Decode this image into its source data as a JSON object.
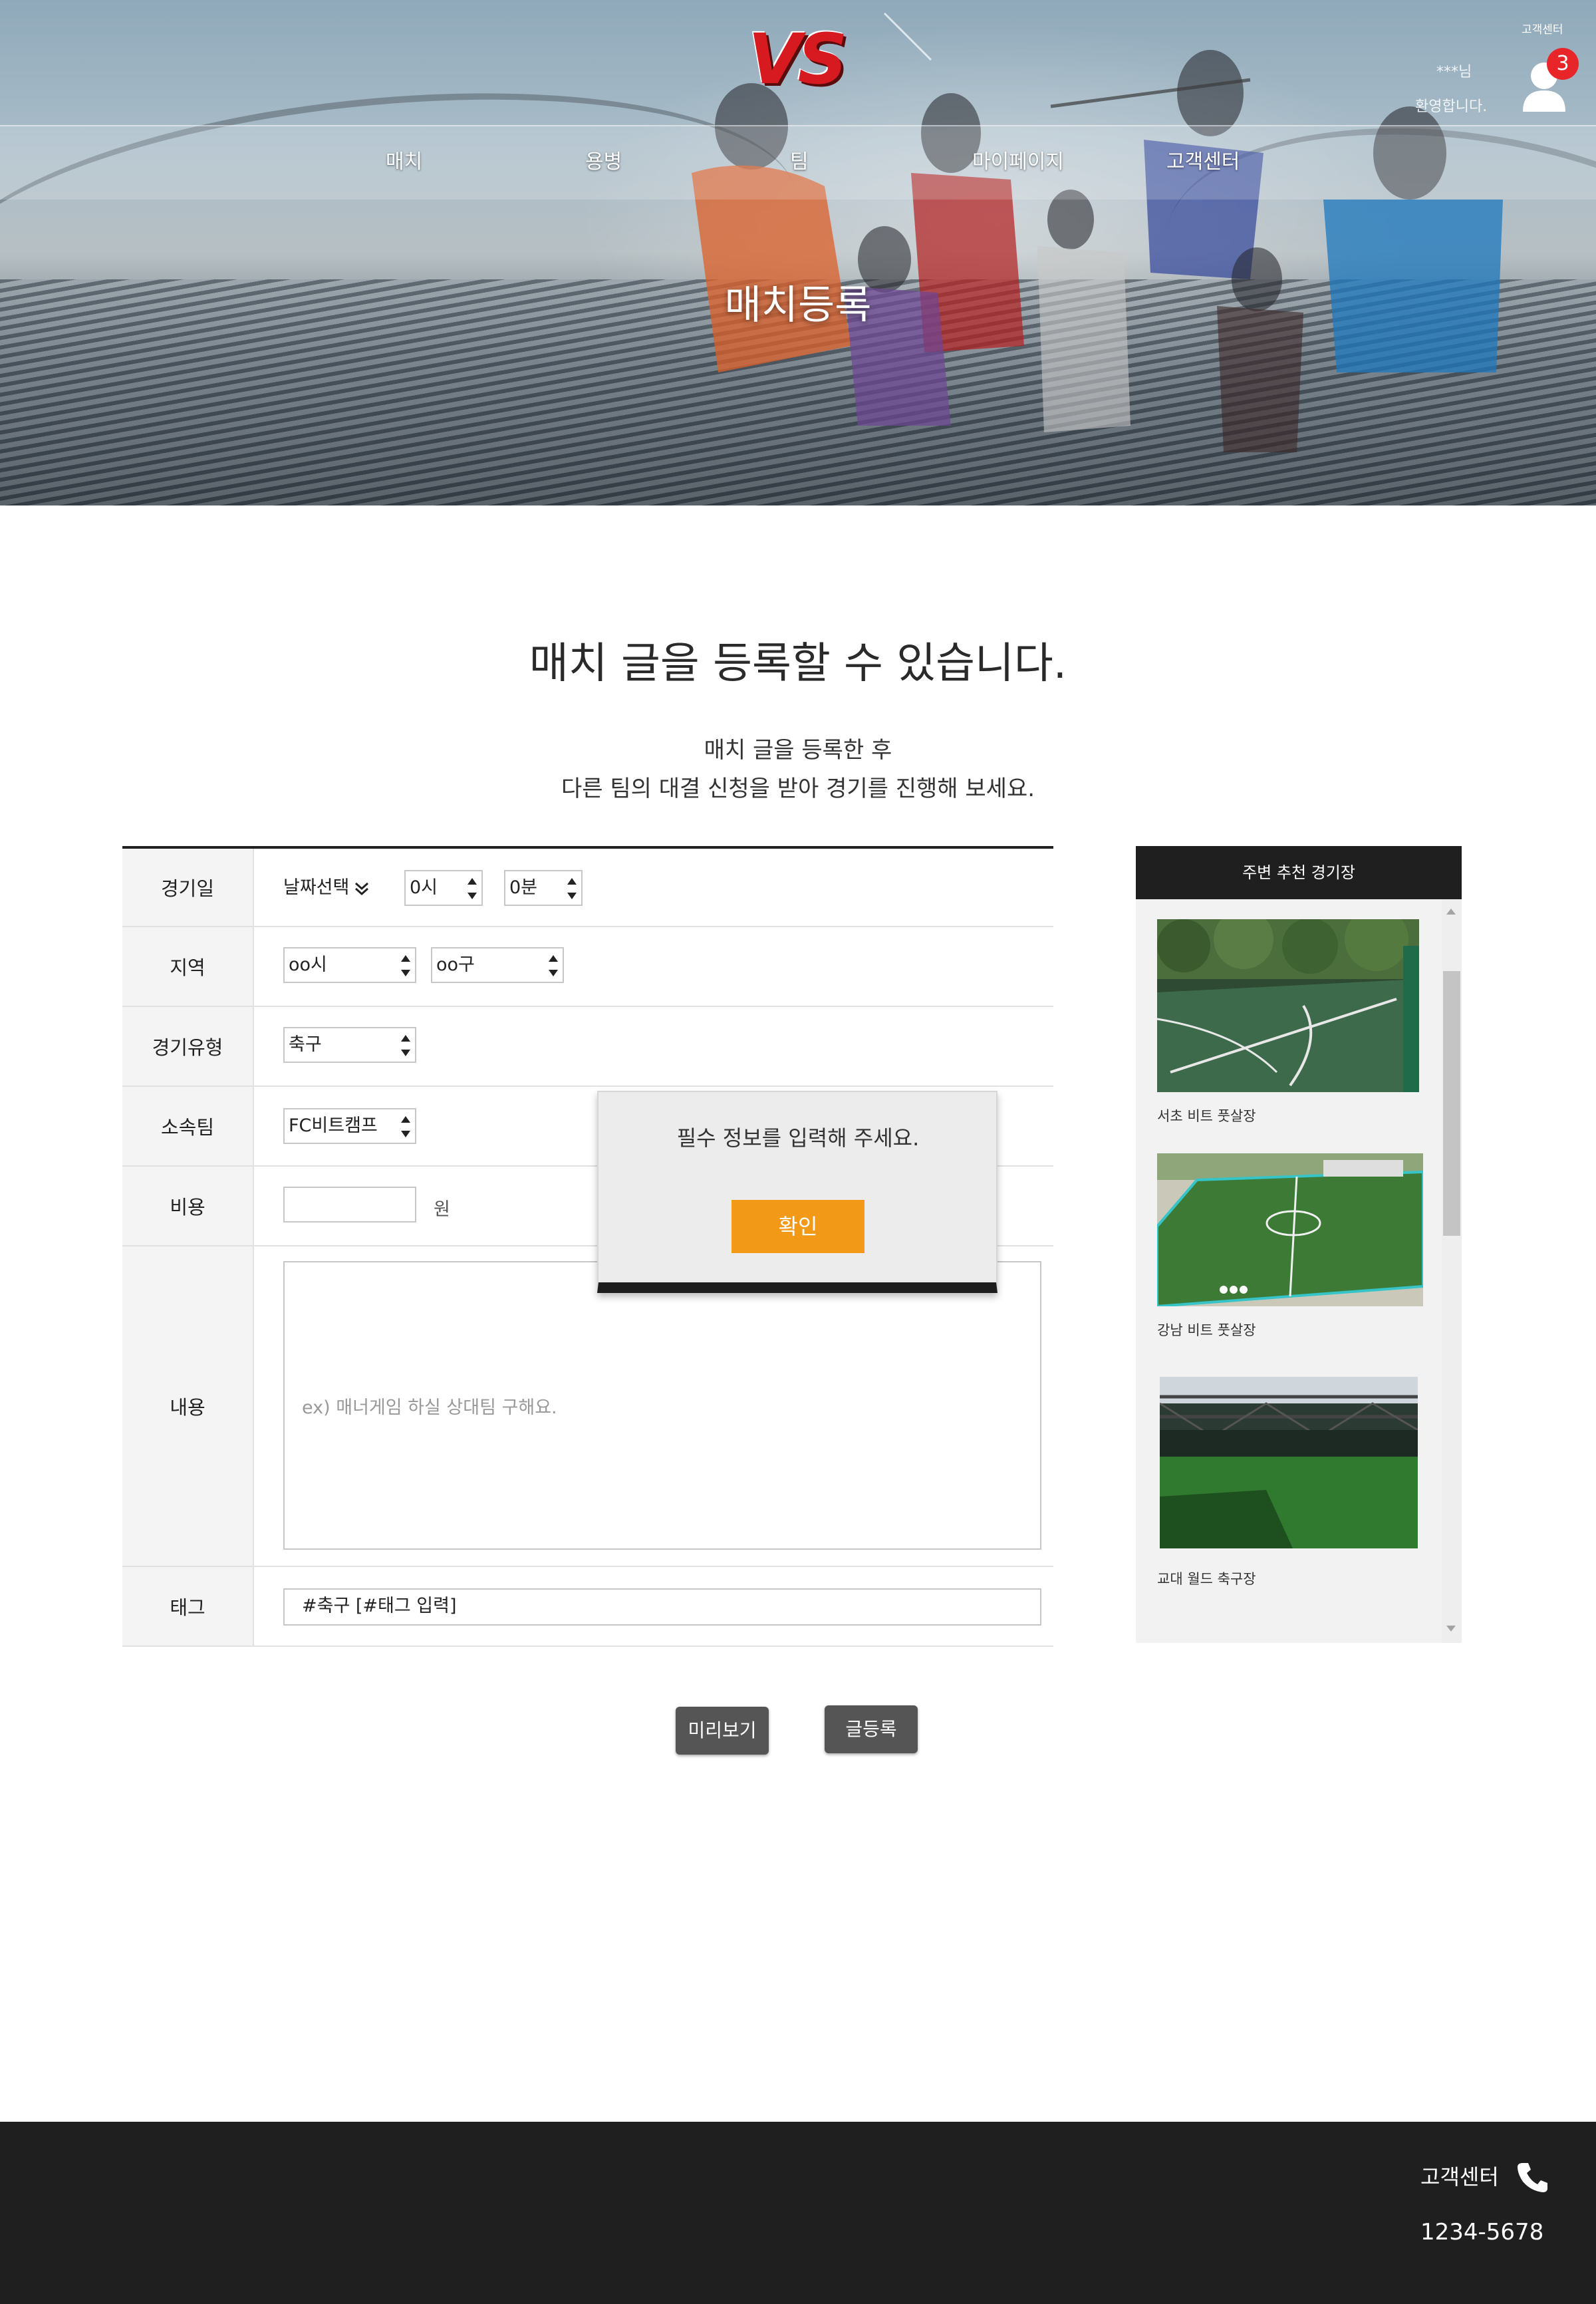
{
  "header": {
    "logo_text": "VS",
    "customer_center": "고객센터",
    "user_name": "***님",
    "user_greeting": "환영합니다.",
    "notification_count": "3",
    "nav": [
      "매치",
      "용병",
      "팀",
      "마이페이지",
      "고객센터"
    ],
    "hero_title": "매치등록"
  },
  "intro": {
    "title": "매치 글을 등록할 수 있습니다.",
    "desc_line1": "매치 글을 등록한 후",
    "desc_line2": "다른 팀의 대결 신청을 받아 경기를 진행해 보세요."
  },
  "form": {
    "match_date": {
      "label": "경기일",
      "date_select": "날짜선택",
      "hour": "0시",
      "minute": "0분"
    },
    "region": {
      "label": "지역",
      "city": "oo시",
      "district": "oo구"
    },
    "match_type": {
      "label": "경기유형",
      "value": "축구"
    },
    "team": {
      "label": "소속팀",
      "value": "FC비트캠프"
    },
    "cost": {
      "label": "비용",
      "value": "",
      "unit": "원"
    },
    "content": {
      "label": "내용",
      "placeholder": "ex) 매너게임 하실 상대팀 구해요."
    },
    "tag": {
      "label": "태그",
      "value": "#축구 [#태그 입력]"
    }
  },
  "sidebar": {
    "title": "주변 추천 경기장",
    "venues": [
      {
        "name": "서초 비트 풋살장"
      },
      {
        "name": "강남 비트 풋살장"
      },
      {
        "name": "교대 월드 축구장"
      }
    ]
  },
  "buttons": {
    "preview": "미리보기",
    "submit": "글등록"
  },
  "modal": {
    "message": "필수 정보를 입력해 주세요.",
    "confirm": "확인"
  },
  "footer": {
    "label": "고객센터",
    "phone": "1234-5678"
  },
  "colors": {
    "accent_orange": "#f29a18",
    "badge_red": "#e8262a",
    "logo_red": "#d71920",
    "dark": "#1f1f1f"
  }
}
